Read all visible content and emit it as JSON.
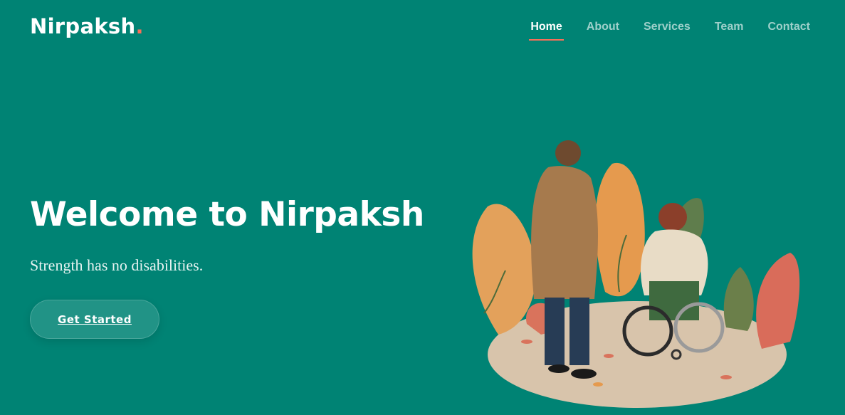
{
  "brand": {
    "name": "Nirpaksh",
    "dot": ".",
    "accent": "#f96f59",
    "background": "#008374"
  },
  "nav": {
    "items": [
      {
        "label": "Home",
        "active": true
      },
      {
        "label": "About",
        "active": false
      },
      {
        "label": "Services",
        "active": false
      },
      {
        "label": "Team",
        "active": false
      },
      {
        "label": "Contact",
        "active": false
      }
    ]
  },
  "hero": {
    "title": "Welcome to Nirpaksh",
    "subtitle": "Strength has no disabilities.",
    "cta_label": "Get Started",
    "illustration": "person-with-wheelchair-companion-illustration"
  }
}
